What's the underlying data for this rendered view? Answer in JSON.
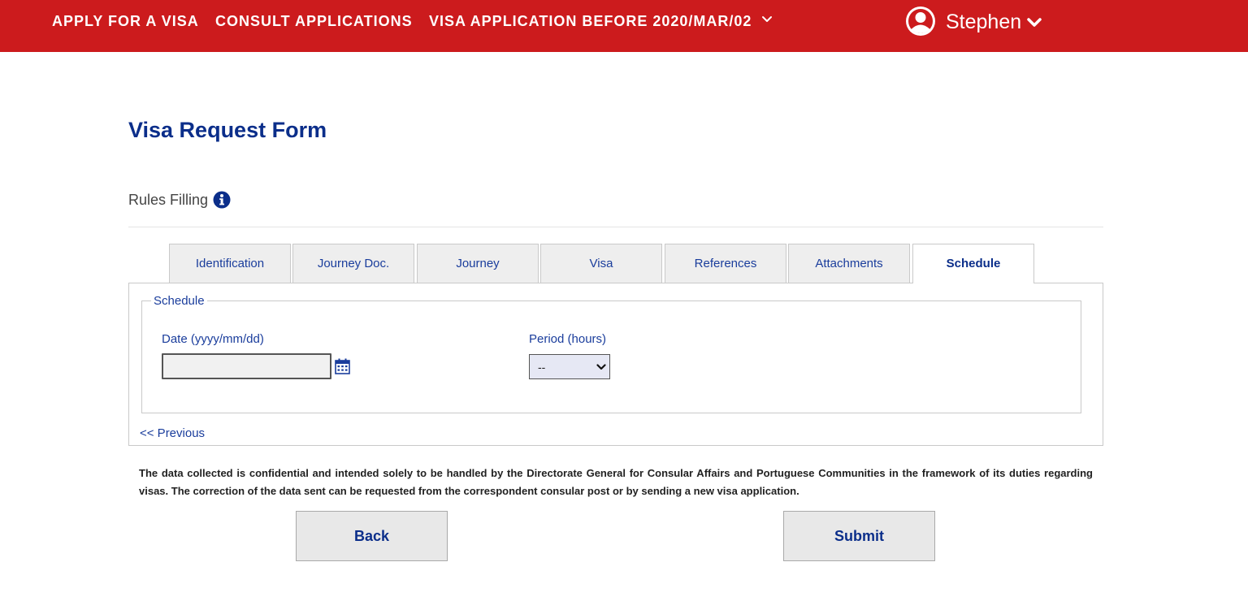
{
  "nav": {
    "items": [
      {
        "label": "APPLY FOR A VISA"
      },
      {
        "label": "CONSULT APPLICATIONS"
      },
      {
        "label": "VISA APPLICATION BEFORE 2020/MAR/02"
      }
    ],
    "user_name": "Stephen"
  },
  "page": {
    "title": "Visa Request Form",
    "rules_label": "Rules Filling"
  },
  "tabs": [
    {
      "label": "Identification"
    },
    {
      "label": "Journey Doc."
    },
    {
      "label": "Journey"
    },
    {
      "label": "Visa"
    },
    {
      "label": "References"
    },
    {
      "label": "Attachments"
    },
    {
      "label": "Schedule",
      "active": true
    }
  ],
  "schedule": {
    "legend": "Schedule",
    "date_label": "Date (yyyy/mm/dd)",
    "date_value": "",
    "period_label": "Period (hours)",
    "period_selected": "--",
    "previous_link": "<< Previous"
  },
  "disclaimer": "The data collected is confidential and intended solely to be handled by the Directorate General for Consular Affairs and Portuguese Communities in the framework of its duties regarding visas. The correction of the data sent can be requested from the correspondent consular post or by sending a new visa application.",
  "buttons": {
    "back": "Back",
    "submit": "Submit"
  },
  "colors": {
    "brand_red": "#cc1b1d",
    "primary_blue": "#0b2e8a",
    "link_blue": "#1a3d9c"
  },
  "icons": {
    "user": "user-circle-icon",
    "info": "info-circle-icon",
    "calendar": "calendar-icon",
    "dropdown": "chevron-down-icon"
  }
}
